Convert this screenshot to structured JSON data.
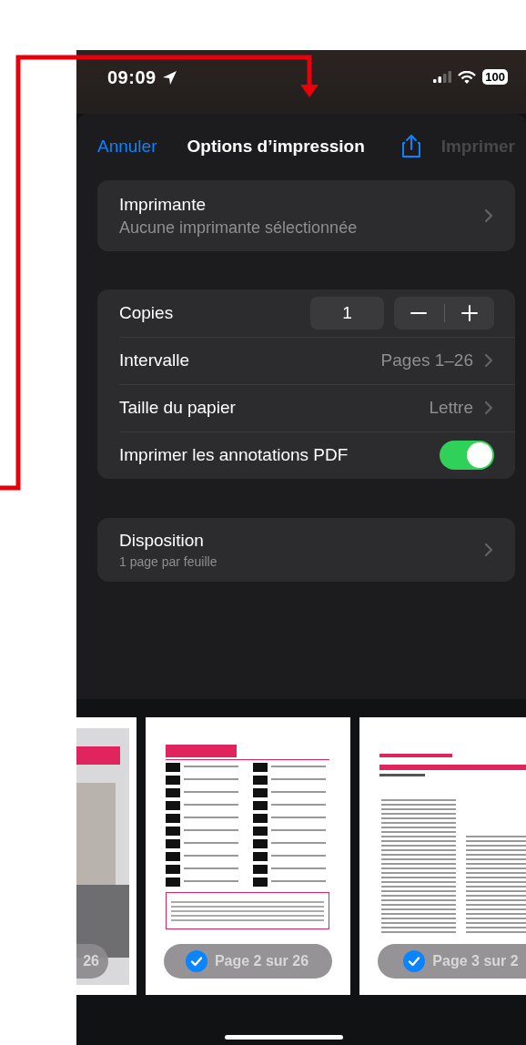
{
  "status_bar": {
    "time": "09:09",
    "battery": "100"
  },
  "nav": {
    "cancel": "Annuler",
    "title": "Options d’impression",
    "print": "Imprimer",
    "print_disabled": true
  },
  "printer": {
    "label": "Imprimante",
    "value": "Aucune imprimante sélectionnée"
  },
  "options": [
    {
      "kind": "stepper",
      "label": "Copies",
      "value": "1"
    },
    {
      "kind": "link",
      "label": "Intervalle",
      "value": "Pages 1–26"
    },
    {
      "kind": "link",
      "label": "Taille du papier",
      "value": "Lettre"
    },
    {
      "kind": "toggle",
      "label": "Imprimer les annotations PDF",
      "on": true
    }
  ],
  "layout": {
    "label": "Disposition",
    "value": "1 page par feuille"
  },
  "pages": [
    {
      "kind": "cover",
      "badge": "26"
    },
    {
      "kind": "contents",
      "badge": "Page 2 sur 26",
      "selected": true
    },
    {
      "kind": "article",
      "badge": "Page 3 sur 2",
      "selected": true
    }
  ]
}
